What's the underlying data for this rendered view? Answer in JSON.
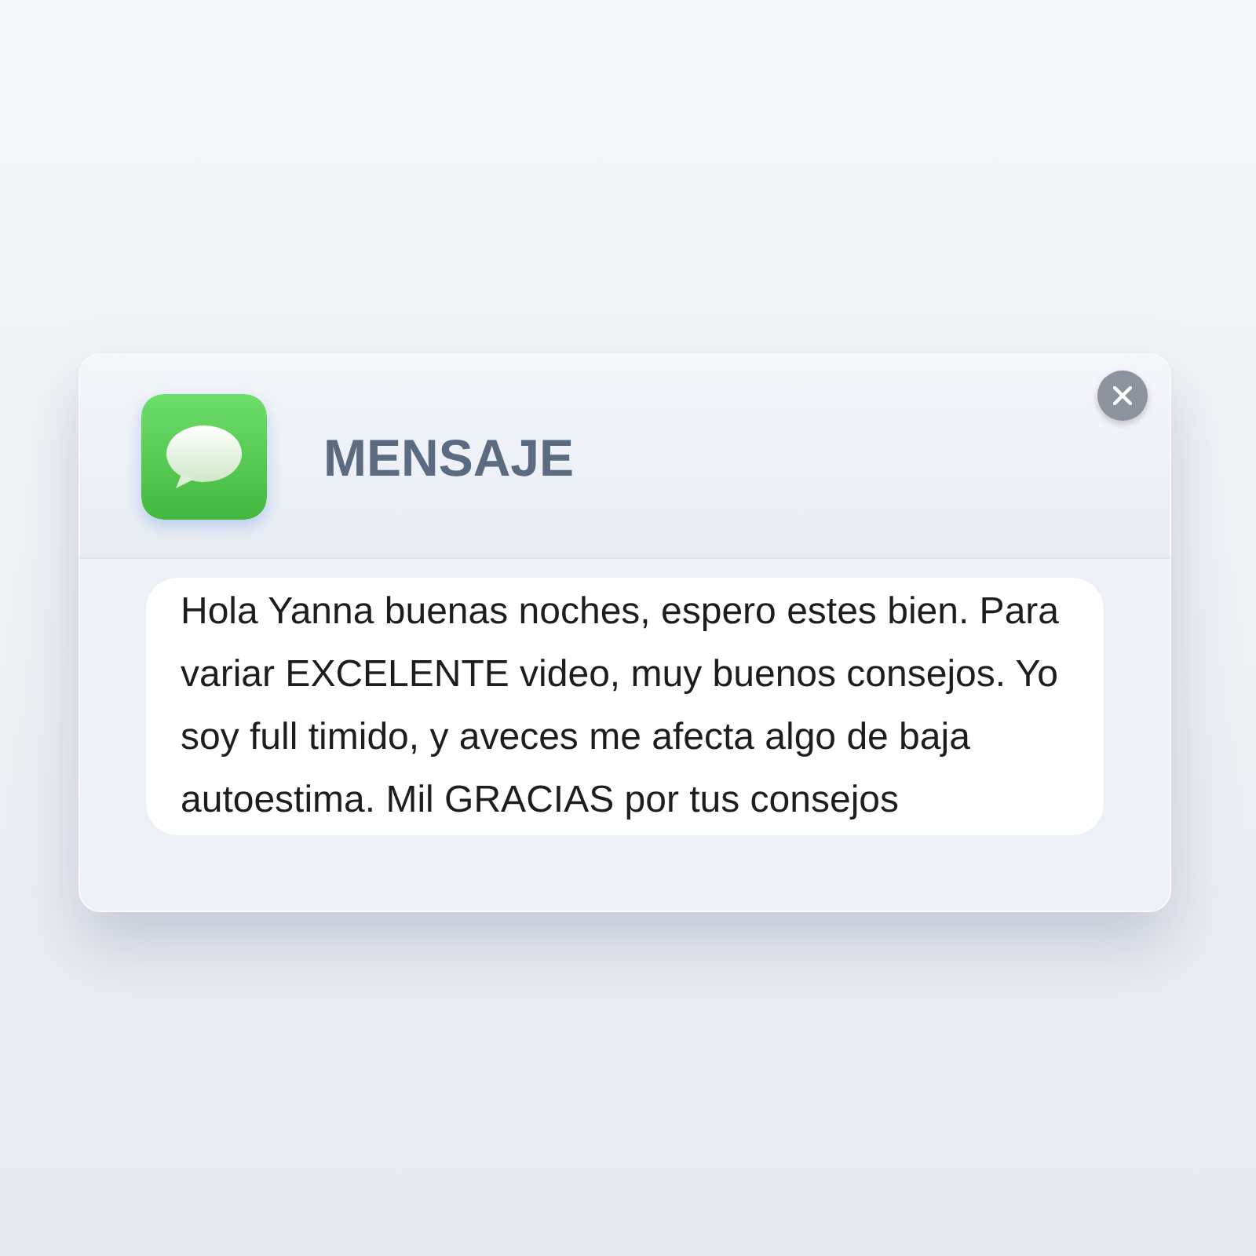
{
  "notification": {
    "title": "MENSAJE",
    "message": "Hola Yanna buenas noches, espero estes bien. Para variar EXCELENTE video, muy buenos consejos. Yo soy full timido, y aveces me afecta algo de baja autoestima. Mil GRACIAS por tus consejos"
  }
}
